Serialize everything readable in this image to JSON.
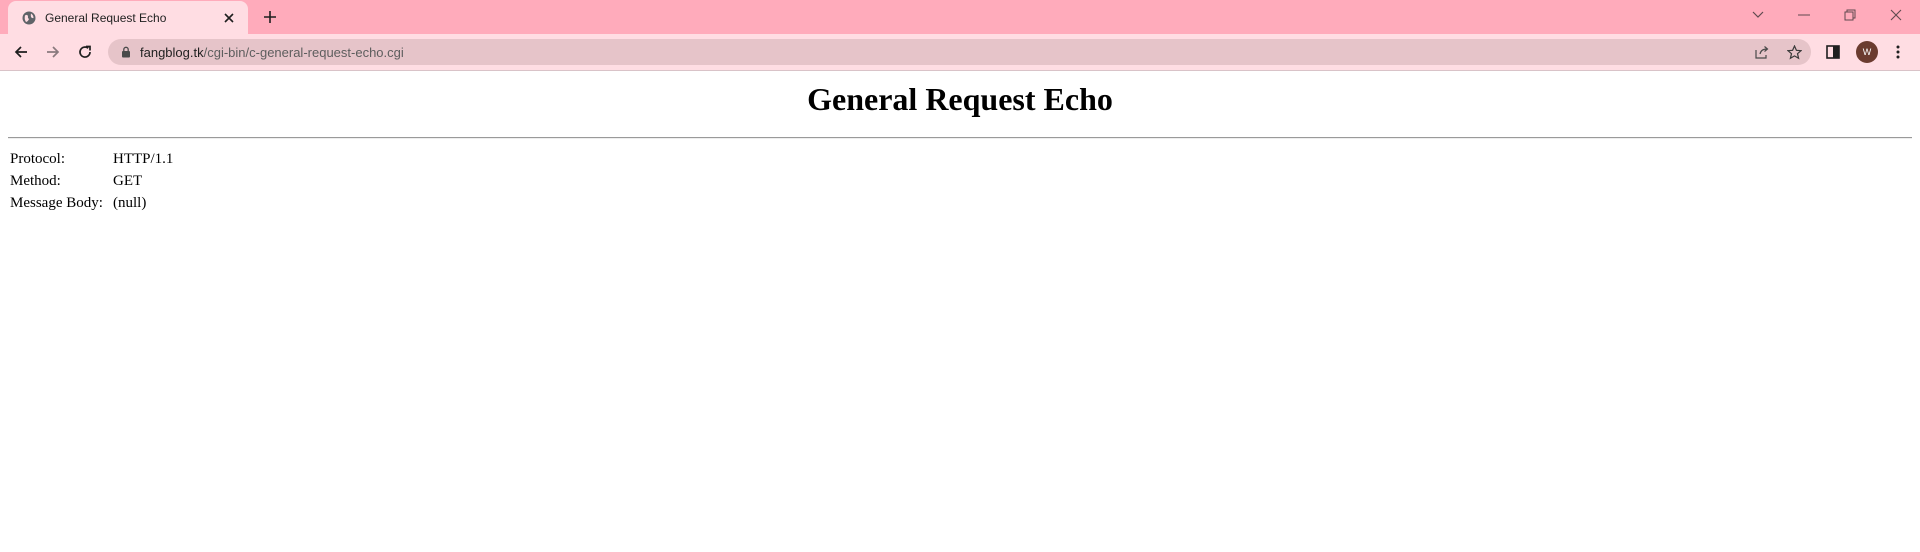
{
  "browser": {
    "tab": {
      "title": "General Request Echo"
    },
    "address_bar": {
      "host": "fangblog.tk",
      "path": "/cgi-bin/c-general-request-echo.cgi"
    },
    "profile_initial": "W",
    "colors": {
      "tabstrip": "#ffabbb",
      "active_tab": "#ffdde3",
      "omnibox": "#e6c4c9"
    }
  },
  "page": {
    "heading": "General Request Echo",
    "rows": [
      {
        "label": "Protocol:",
        "value": "HTTP/1.1"
      },
      {
        "label": "Method:",
        "value": "GET"
      },
      {
        "label": "Message Body:",
        "value": "(null)"
      }
    ]
  }
}
